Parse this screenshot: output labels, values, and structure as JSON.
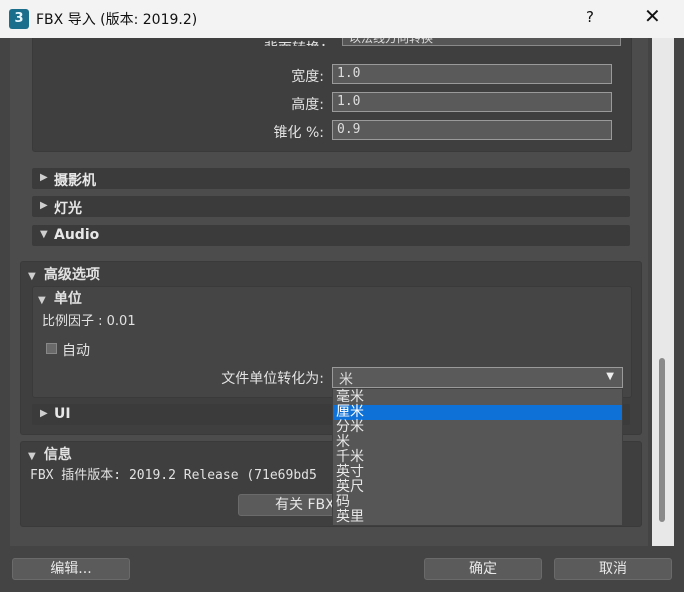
{
  "window": {
    "title": "FBX 导入 (版本: 2019.2)",
    "help": "?",
    "close": "✕",
    "app_icon": "3"
  },
  "camera_section": {
    "partial_label": "背面转换：",
    "partial_value": "以法线方向转换",
    "width_label": "宽度:",
    "width_value": "1.0",
    "height_label": "高度:",
    "height_value": "1.0",
    "taper_label": "锥化 %:",
    "taper_value": "0.9"
  },
  "rollouts": {
    "camera": "摄影机",
    "lights": "灯光",
    "audio": "Audio",
    "ui": "UI"
  },
  "advanced": {
    "title": "高级选项",
    "units_title": "单位",
    "scale_factor": "比例因子 : 0.01",
    "auto_label": "自动",
    "convert_label": "文件单位转化为:",
    "selected_value": "米",
    "options": [
      "毫米",
      "厘米",
      "分米",
      "米",
      "千米",
      "英寸",
      "英尺",
      "码",
      "英里"
    ],
    "highlighted_index": 1
  },
  "info": {
    "title": "信息",
    "plugin_version": "FBX 插件版本: 2019.2 Release (71e69bd5",
    "about_button": "有关 FBX"
  },
  "footer": {
    "edit": "编辑...",
    "ok": "确定",
    "cancel": "取消"
  },
  "arrows": {
    "collapsed": "▶",
    "expanded": "▼",
    "caret": "▼"
  }
}
